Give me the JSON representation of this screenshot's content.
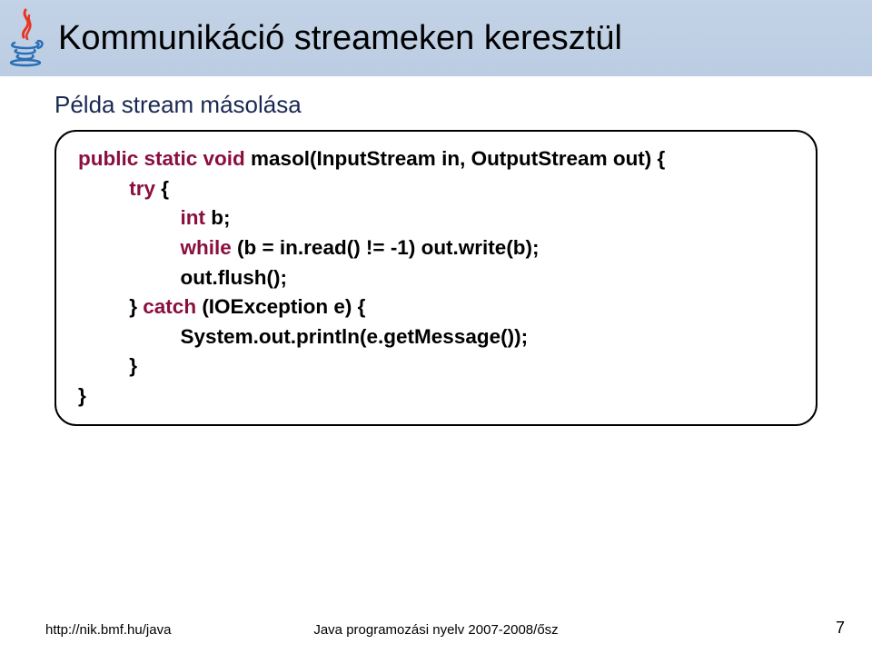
{
  "header": {
    "title": "Kommunikáció streameken keresztül"
  },
  "body": {
    "subtitle": "Példa stream másolása",
    "code": {
      "l1a": "public static void ",
      "l1b": "masol(InputStream in, OutputStream out) {",
      "l2a": "try ",
      "l2b": "{",
      "l3a": "int ",
      "l3b": "b;",
      "l4a": "while ",
      "l4b": "(b = in.read() != -1) out.write(b);",
      "l5": "out.flush();",
      "l6a": "} ",
      "l6b": "catch ",
      "l6c": "(IOException e) {",
      "l7": "System.out.println(e.getMessage());",
      "l8": "}",
      "l9": "}"
    }
  },
  "footer": {
    "left": "http://nik.bmf.hu/java",
    "center": "Java programozási nyelv 2007-2008/ősz",
    "page": "7"
  }
}
